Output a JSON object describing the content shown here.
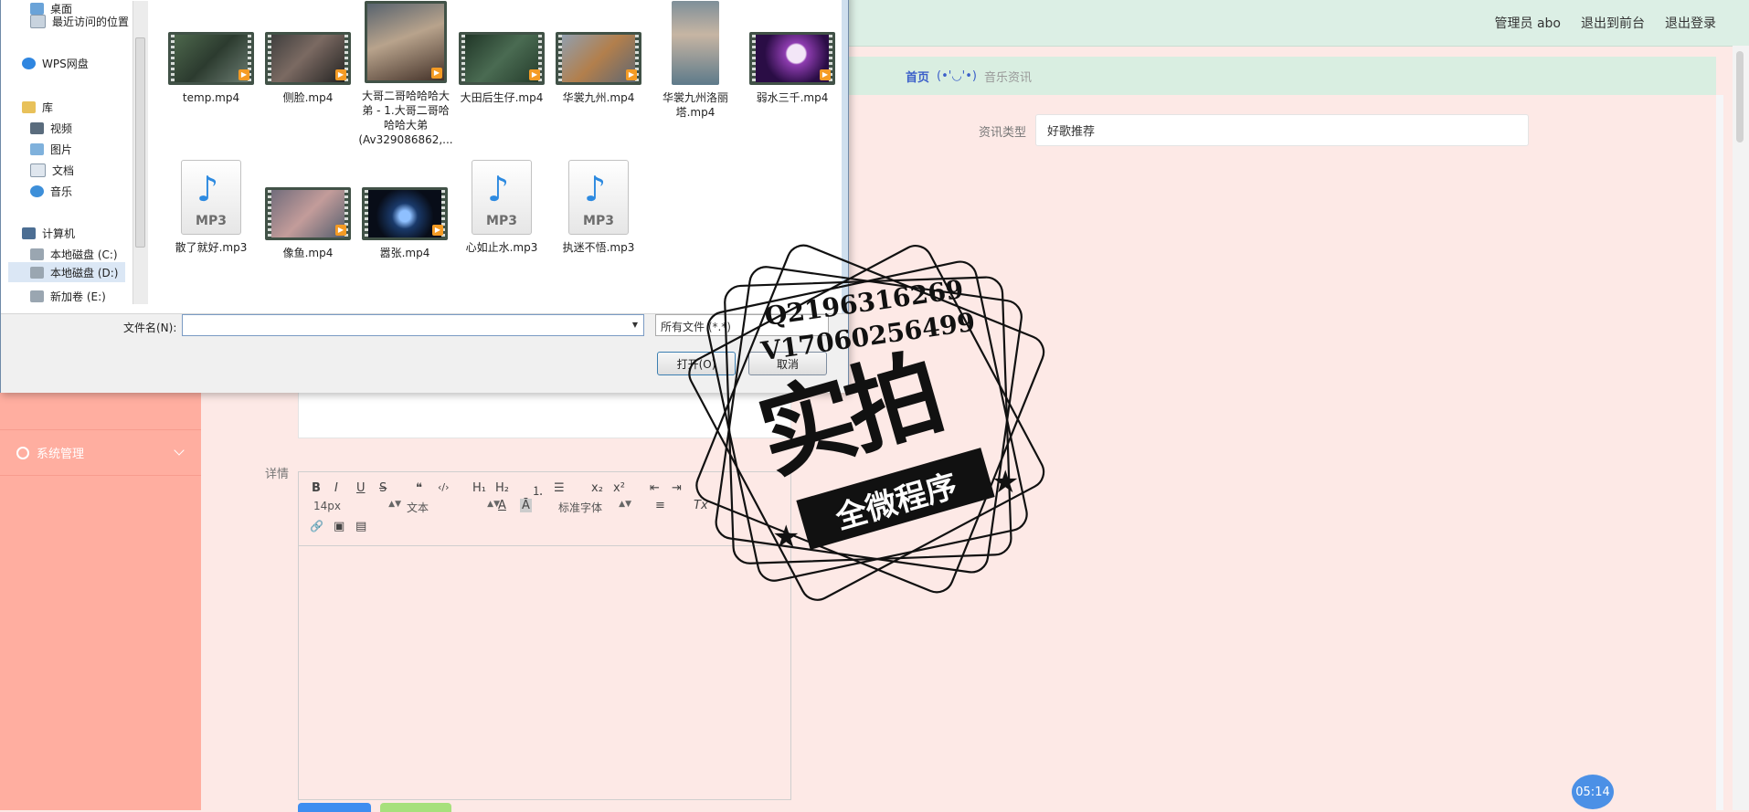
{
  "topbar": {
    "admin_label": "管理员 abo",
    "front_label": "退出到前台",
    "logout_label": "退出登录"
  },
  "breadcrumb": {
    "home": "首页",
    "face": "(•'◡'•)",
    "current": "音乐资讯"
  },
  "sidebar": {
    "items": [
      {
        "label": "系统管理"
      }
    ]
  },
  "form": {
    "type_label": "资讯类型",
    "type_value": "好歌推荐",
    "detail_label": "详情"
  },
  "editor": {
    "font_size": "14px",
    "format": "文本",
    "font_family": "标准字体",
    "buttons": [
      "B",
      "I",
      "U",
      "S",
      "❝",
      "‹/›",
      "H₁",
      "H₂",
      "⒈",
      "☰",
      "x₂",
      "x²",
      "⇤",
      "⇥",
      "A",
      "Ā",
      "≡",
      "Tx",
      "🔗",
      "▣",
      "▤"
    ]
  },
  "timer": "05:14",
  "dialog": {
    "nav": [
      {
        "label": "桌面"
      },
      {
        "label": "最近访问的位置"
      },
      {
        "label": "WPS网盘"
      },
      {
        "label": "库"
      },
      {
        "label": "视频"
      },
      {
        "label": "图片"
      },
      {
        "label": "文档"
      },
      {
        "label": "音乐"
      },
      {
        "label": "计算机"
      },
      {
        "label": "本地磁盘 (C:)"
      },
      {
        "label": "本地磁盘 (D:)"
      },
      {
        "label": "新加卷 (E:)"
      }
    ],
    "files_row1": [
      {
        "name": "temp.mp4"
      },
      {
        "name": "侧脸.mp4"
      },
      {
        "name": "大哥二哥哈哈哈大弟 - 1.大哥二哥哈哈哈大弟(Av329086862,..."
      },
      {
        "name": "大田后生仔.mp4"
      },
      {
        "name": "华裳九州.mp4"
      },
      {
        "name": "华裳九州洛丽塔.mp4"
      },
      {
        "name": "弱水三千.mp4"
      }
    ],
    "files_row2": [
      {
        "name": "散了就好.mp3"
      },
      {
        "name": "像鱼.mp4"
      },
      {
        "name": "嚣张.mp4"
      },
      {
        "name": "心如止水.mp3"
      },
      {
        "name": "执迷不悟.mp3"
      }
    ],
    "filename_label": "文件名(N):",
    "filename_value": "",
    "filetype": "所有文件 (*.*)",
    "open_label": "打开(O)",
    "cancel_label": "取消"
  },
  "watermark": {
    "line1": "Q2196316269",
    "line2": "V17060256499",
    "big": "实拍",
    "banner": "全微程序"
  },
  "colors": {
    "topbar": "#dcefe5",
    "sidebar": "#ffaea0",
    "content": "#fde9e6",
    "accent": "#3b5fc9",
    "timer": "#4b90e6"
  }
}
